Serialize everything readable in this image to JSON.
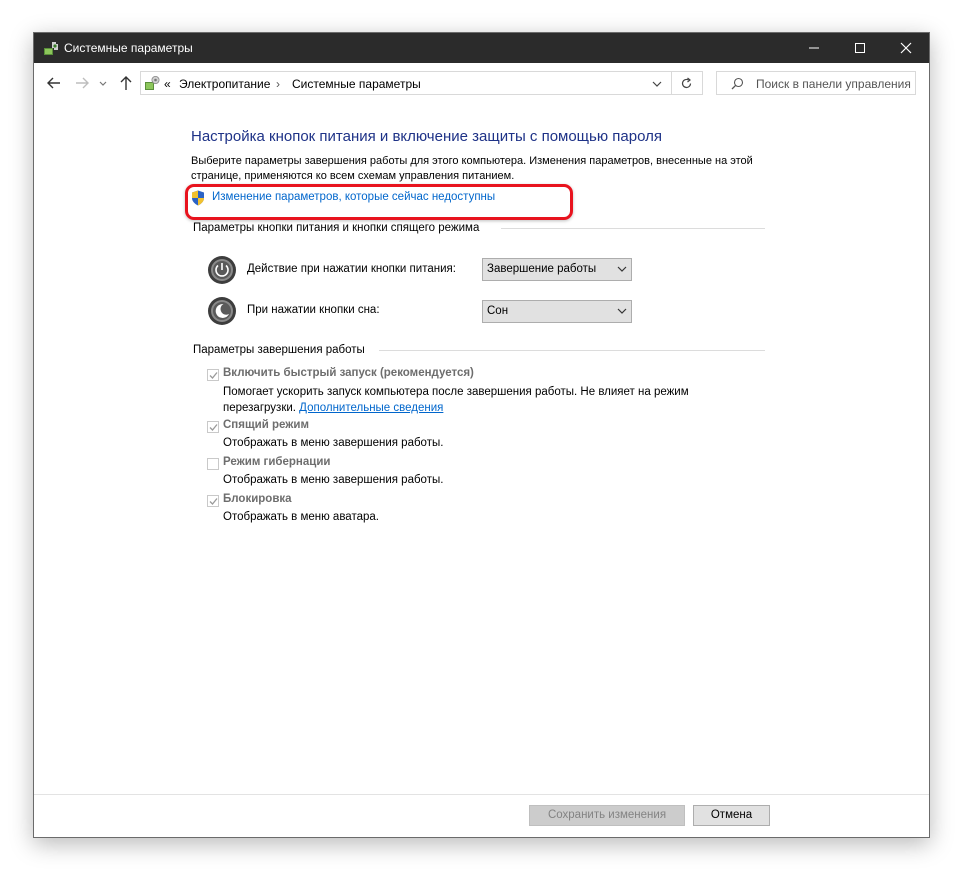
{
  "window": {
    "title": "Системные параметры"
  },
  "breadcrumb": {
    "overflow": "«",
    "items": [
      "Электропитание",
      "Системные параметры"
    ]
  },
  "search": {
    "placeholder": "Поиск в панели управления"
  },
  "page": {
    "heading": "Настройка кнопок питания и включение защиты с помощью пароля",
    "description": "Выберите параметры завершения работы для этого компьютера. Изменения параметров, внесенные на этой странице, применяются ко всем схемам управления питанием.",
    "change_link": "Изменение параметров, которые сейчас недоступны"
  },
  "power_buttons": {
    "group_title": "Параметры кнопки питания и кнопки спящего режима",
    "power_action_label": "Действие при нажатии кнопки питания:",
    "power_action_value": "Завершение работы",
    "sleep_action_label": "При нажатии кнопки сна:",
    "sleep_action_value": "Сон"
  },
  "shutdown": {
    "group_title": "Параметры завершения работы",
    "options": [
      {
        "title": "Включить быстрый запуск (рекомендуется)",
        "desc": "Помогает ускорить запуск компьютера после завершения работы. Не влияет на режим перезагрузки.",
        "link": "Дополнительные сведения",
        "checked": true
      },
      {
        "title": "Спящий режим",
        "desc": "Отображать в меню завершения работы.",
        "checked": true
      },
      {
        "title": "Режим гибернации",
        "desc": "Отображать в меню завершения работы.",
        "checked": false
      },
      {
        "title": "Блокировка",
        "desc": "Отображать в меню аватара.",
        "checked": true
      }
    ]
  },
  "footer": {
    "save_label": "Сохранить изменения",
    "cancel_label": "Отмена"
  },
  "colors": {
    "titlebar": "#2b2b2b",
    "heading": "#1e3287",
    "link": "#0066cc",
    "highlight": "#e8131e"
  }
}
